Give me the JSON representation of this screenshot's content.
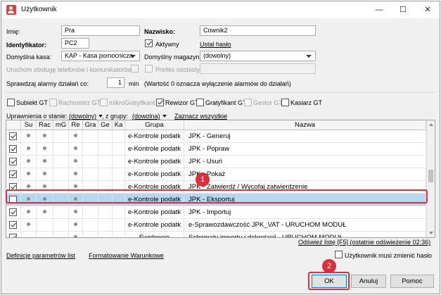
{
  "window": {
    "title": "Użytkownik",
    "minimize": "—",
    "maximize": "☐",
    "close": "✕"
  },
  "form": {
    "imie_label": "Imię:",
    "imie_value": "Pra",
    "nazwisko_label": "Nazwisko:",
    "nazwisko_value": "Cownik2",
    "identyfikator_label": "Identyfikator:",
    "identyfikator_value": "PC2",
    "aktywny_label": "Aktywny",
    "ustal_haslo": "Ustal hasło",
    "domyslna_kasa_label": "Domyślna kasa:",
    "domyslna_kasa_value": "KAP - Kasa pomocnicza",
    "domyslny_magazyn_label": "Domyślny magazyn:",
    "domyslny_magazyn_value": "(dowolny)",
    "uruchom_label": "Uruchom obsługę telefonów i komunikatorów",
    "prefiks_label": "Prefiks osobisty:",
    "sprawdzaj_label": "Sprawdzaj alarmy działań co:",
    "sprawdzaj_value": "1",
    "min_label": "min",
    "wartosc_note": "(Wartość 0 oznacza wyłączenie alarmów do działań)"
  },
  "modules": [
    {
      "label": "Subiekt GT",
      "checked": false,
      "disabled": false
    },
    {
      "label": "Rachmistrz GT",
      "checked": false,
      "disabled": true
    },
    {
      "label": "mikroGratyfikant GT",
      "checked": false,
      "disabled": true
    },
    {
      "label": "Rewizor GT",
      "checked": true,
      "disabled": false
    },
    {
      "label": "Gratyfikant GT",
      "checked": false,
      "disabled": false
    },
    {
      "label": "Gestor GT",
      "checked": false,
      "disabled": true
    },
    {
      "label": "Kasiarz GT",
      "checked": false,
      "disabled": false
    }
  ],
  "filters": {
    "uprawnienia_label": "Uprawnienia o stanie:",
    "stan_value": "(dowolny)",
    "grupy_label": ", z grupy:",
    "grupa_value": "(dowolna)",
    "zaznacz": "Zaznacz wszystkie"
  },
  "grid": {
    "columns": [
      "Su",
      "Rac",
      "mG",
      "Re",
      "Gra",
      "Ge",
      "Ka",
      "Grupa",
      "Nazwa"
    ],
    "rows": [
      {
        "checked": true,
        "su": true,
        "rac": true,
        "re": true,
        "grupa": "e-Kontrole podatk",
        "nazwa": "JPK - Generuj"
      },
      {
        "checked": true,
        "su": true,
        "rac": true,
        "re": true,
        "grupa": "e-Kontrole podatk",
        "nazwa": "JPK - Popraw"
      },
      {
        "checked": true,
        "su": true,
        "rac": true,
        "re": true,
        "grupa": "e-Kontrole podatk",
        "nazwa": "JPK - Usuń"
      },
      {
        "checked": true,
        "su": true,
        "rac": true,
        "re": true,
        "grupa": "e-Kontrole podatk",
        "nazwa": "JPK - Pokaż"
      },
      {
        "checked": true,
        "su": true,
        "rac": true,
        "re": true,
        "grupa": "e-Kontrole podatk",
        "nazwa": "JPK - Zatwierdź / Wycofaj zatwierdzenie"
      },
      {
        "checked": false,
        "su": true,
        "rac": true,
        "re": true,
        "grupa": "e-Kontrole podatk",
        "nazwa": "JPK - Eksportuj"
      },
      {
        "checked": true,
        "su": true,
        "rac": true,
        "re": true,
        "grupa": "e-Kontrole podatk",
        "nazwa": "JPK - Importuj"
      },
      {
        "checked": true,
        "su": true,
        "rac": false,
        "re": true,
        "grupa": "e-Kontrole podatk",
        "nazwa": "e-Sprawozdawczość JPK_VAT - URUCHOM MODUŁ"
      },
      {
        "checked": true,
        "su": false,
        "rac": false,
        "re": true,
        "grupa": "Ewidencje",
        "nazwa": "Schematy importu i dekretacji - URUCHOM MODUŁ"
      }
    ]
  },
  "refresh": "Odśwież listę [F5] (ostatnie odświeżenie 02:36)",
  "bottom": {
    "definicje": "Definicje parametrów list",
    "formatowanie": "Formatowanie Warunkowe",
    "musi_zmienic": "Użytkownik musi zmienić hasło"
  },
  "buttons": {
    "ok": "OK",
    "anuluj": "Anuluj",
    "pomoc": "Pomoc"
  },
  "annotations": {
    "badge1": "1",
    "badge2": "2"
  },
  "colors": {
    "highlight": "#d9303b",
    "selection": "#b6d6f2",
    "default_button_border": "#0078d7"
  }
}
